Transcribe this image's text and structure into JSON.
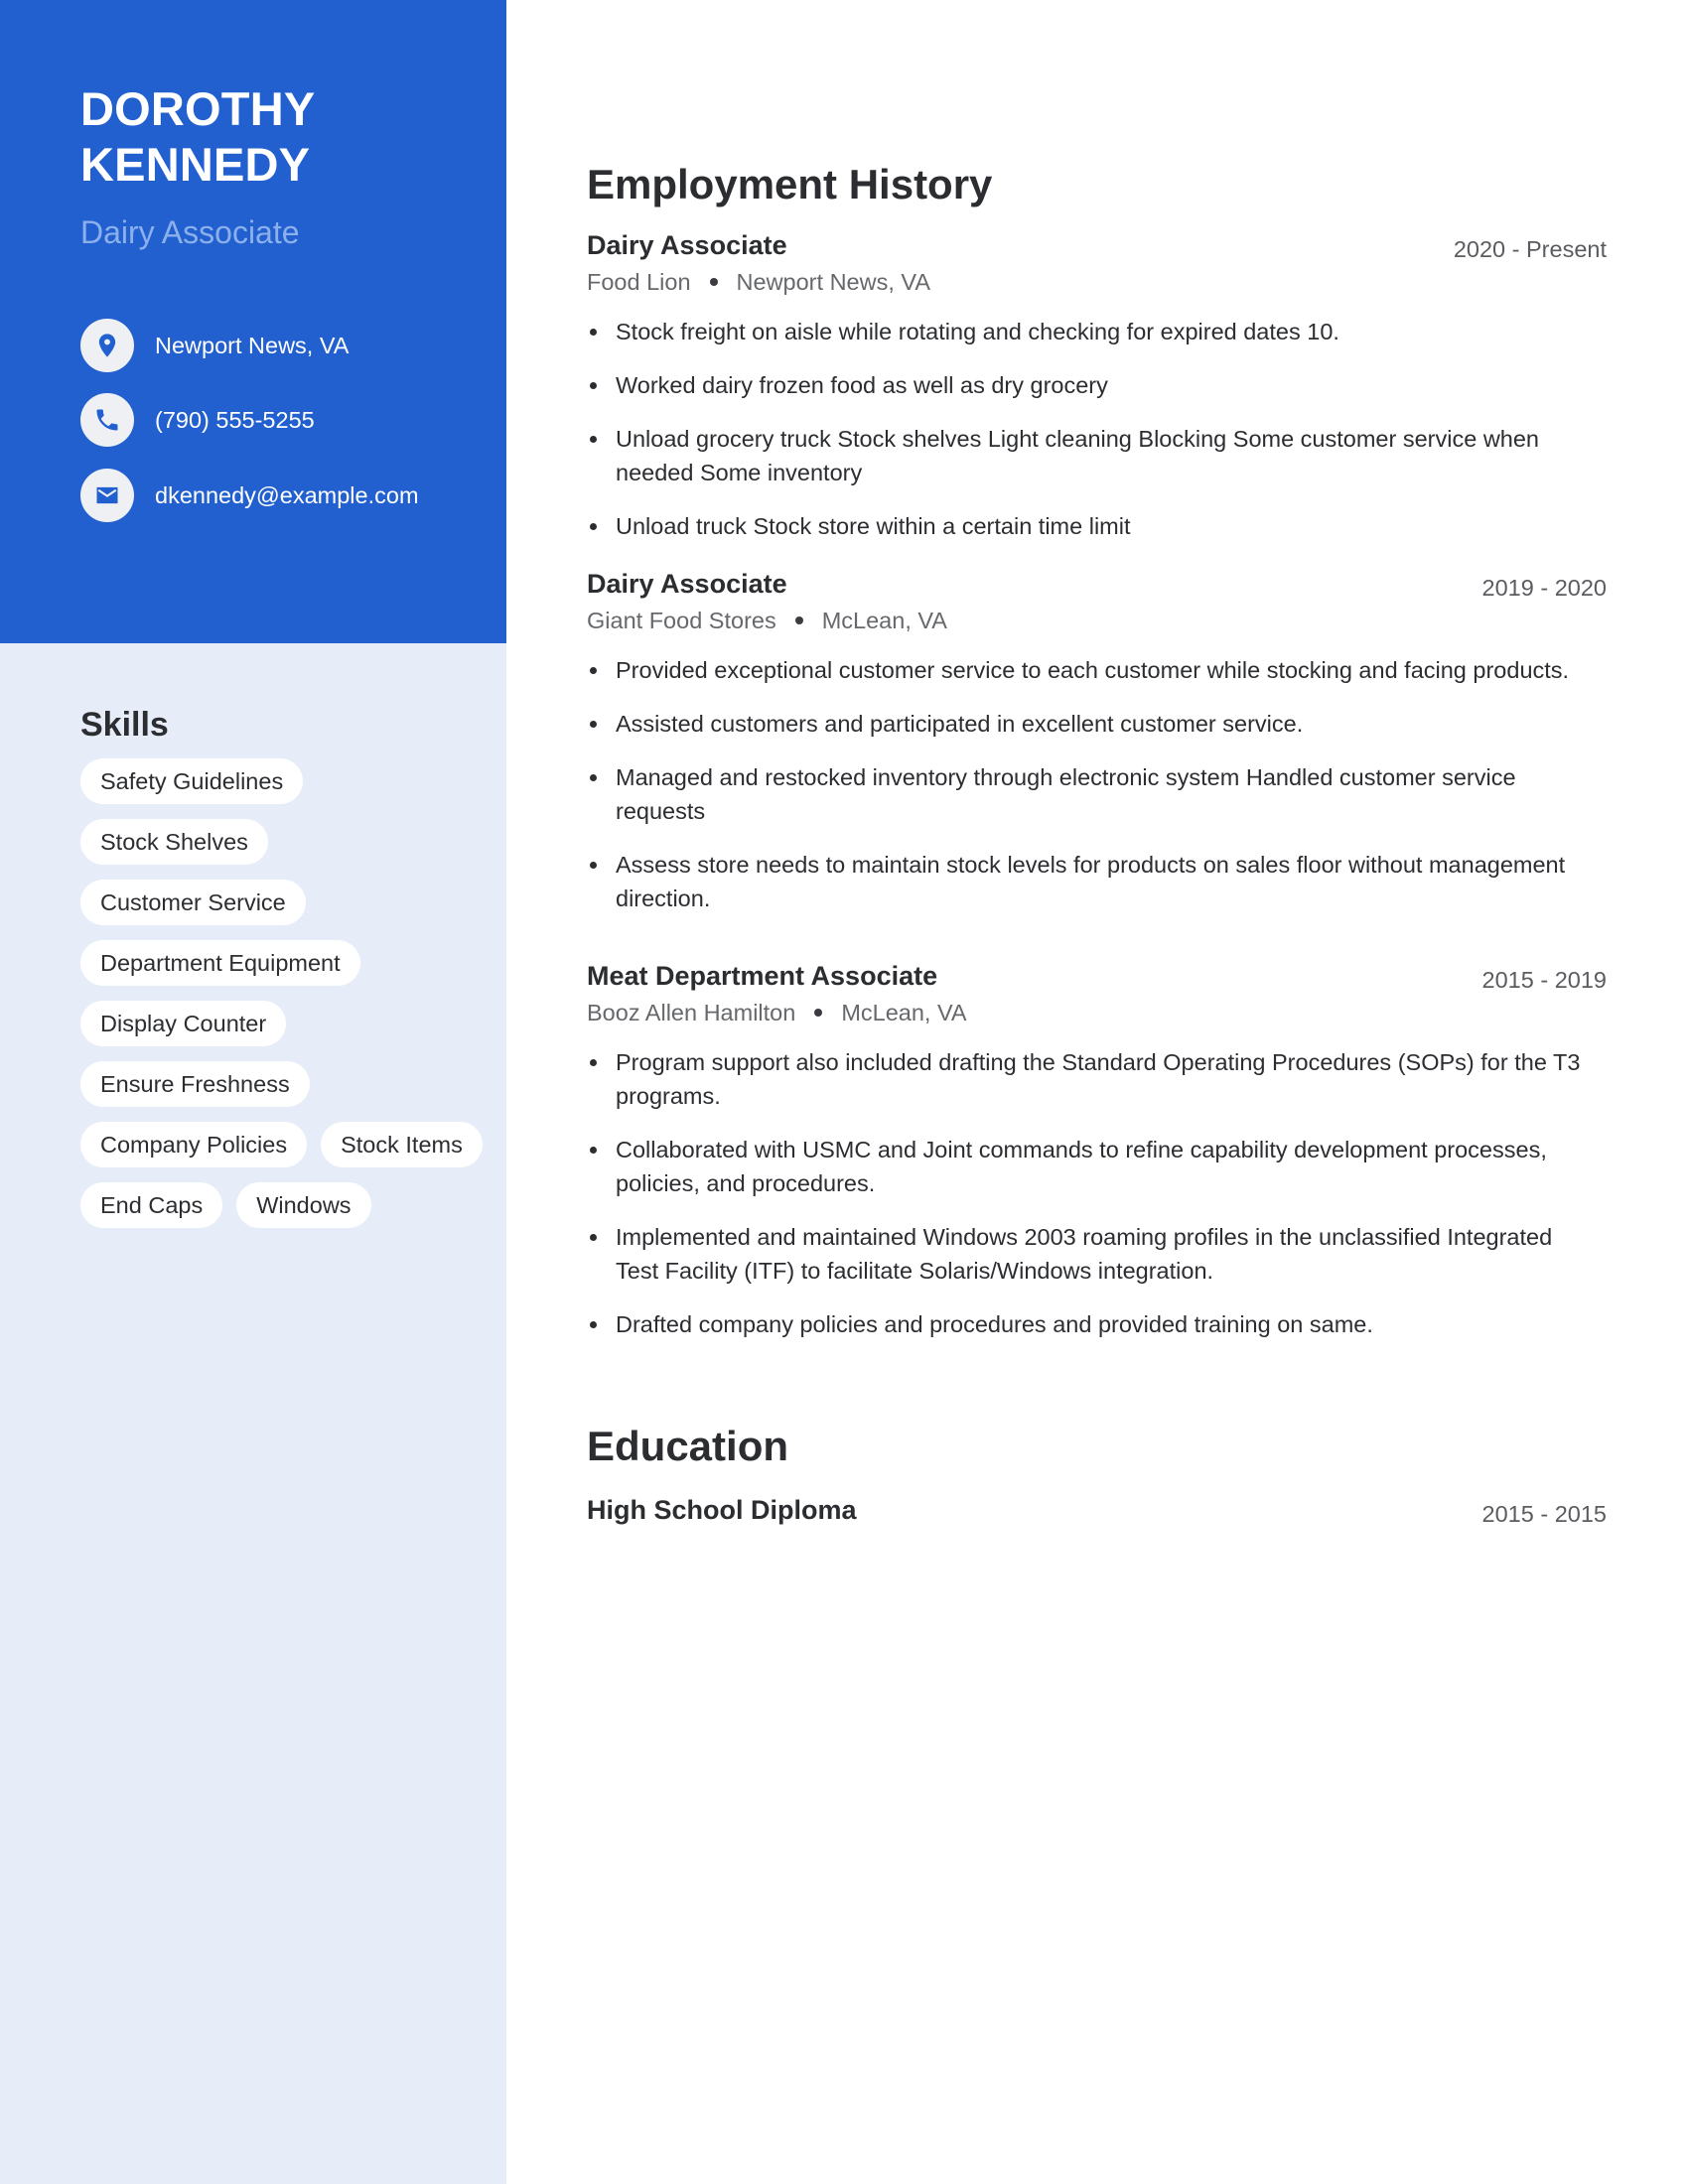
{
  "profile": {
    "first_name": "DOROTHY",
    "last_name": "KENNEDY",
    "title": "Dairy Associate"
  },
  "contact": {
    "location": {
      "icon": "map-pin-icon",
      "text": "Newport News, VA"
    },
    "phone": {
      "icon": "phone-icon",
      "text": "(790) 555-5255"
    },
    "email": {
      "icon": "envelope-icon",
      "text": "dkennedy@example.com"
    }
  },
  "skills": {
    "title": "Skills",
    "items": [
      "Safety Guidelines",
      "Stock Shelves",
      "Customer Service",
      "Department Equipment",
      "Display Counter",
      "Ensure Freshness",
      "Company Policies",
      "Stock Items",
      "End Caps",
      "Windows"
    ]
  },
  "employment": {
    "title": "Employment History",
    "jobs": [
      {
        "role": "Dairy Associate",
        "dates": "2020 - Present",
        "company": "Food Lion",
        "location": "Newport News, VA",
        "bullets": [
          "Stock freight on aisle while rotating and checking for expired dates 10.",
          "Worked dairy frozen food as well as dry grocery",
          "Unload grocery truck Stock shelves Light cleaning Blocking Some customer service when needed Some inventory",
          "Unload truck Stock store within a certain time limit"
        ]
      },
      {
        "role": "Dairy Associate",
        "dates": "2019 - 2020",
        "company": "Giant Food Stores",
        "location": "McLean, VA",
        "bullets": [
          "Provided exceptional customer service to each customer while stocking and facing products.",
          "Assisted customers and participated in excellent customer service.",
          "Managed and restocked inventory through electronic system Handled customer service requests",
          "Assess store needs to maintain stock levels for products on sales floor without management direction."
        ]
      },
      {
        "role": "Meat Department Associate",
        "dates": "2015 - 2019",
        "company": "Booz Allen Hamilton",
        "location": "McLean, VA",
        "bullets": [
          "Program support also included drafting the Standard Operating Procedures (SOPs) for the T3 programs.",
          "Collaborated with USMC and Joint commands to refine capability development processes, policies, and procedures.",
          "Implemented and maintained Windows 2003 roaming profiles in the unclassified Integrated Test Facility (ITF) to facilitate Solaris/Windows integration.",
          "Drafted company policies and procedures and provided training on same."
        ]
      }
    ]
  },
  "education": {
    "title": "Education",
    "entries": [
      {
        "degree": "High School Diploma",
        "dates": "2015 - 2015"
      }
    ]
  },
  "colors": {
    "sidebar_header": "#2260d0",
    "sidebar_body": "#e6edf9",
    "title_accent": "#8cb0ec",
    "text": "#2b2d31",
    "muted": "#66686c"
  }
}
